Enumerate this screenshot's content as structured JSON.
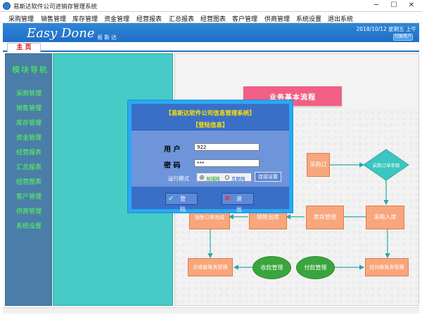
{
  "window": {
    "title": "易斯达软件公司进销存管理系统",
    "controls": [
      "─",
      "☐",
      "✕"
    ]
  },
  "menubar": [
    "采购管理",
    "销售管理",
    "库存管理",
    "资金管理",
    "经营报表",
    "汇总报表",
    "经营图表",
    "客户管理",
    "供商管理",
    "系统设置",
    "退出系统"
  ],
  "banner": {
    "brand": "Easy Done",
    "brand_cn": "易斯达",
    "datetime": "2018/10/12  星期五  上午",
    "switch_label": "切换用户"
  },
  "tab": {
    "label": "主 页"
  },
  "nav": {
    "title": "模块导航",
    "items": [
      "采购管理",
      "销售管理",
      "库存管理",
      "资金管理",
      "经营报表",
      "汇总报表",
      "经营图表",
      "客户管理",
      "供商管理",
      "系统设置"
    ]
  },
  "flow": {
    "title": "业务基本流程",
    "purchase_order": "采购订单",
    "po_approval": "采购订单审核",
    "purchase_in": "采购入库",
    "inventory": "库存管理",
    "sales_out": "销售出库",
    "sales_done": "销售订单完成",
    "receivable": "应收款账务管理",
    "collection": "收款管理",
    "payment": "付款管理",
    "payable": "应付款账务管理"
  },
  "login": {
    "title": "【易斯达软件公司信息管理系统】",
    "subtitle": "【登陆信息】",
    "user_label": "用  户",
    "user_value": "922",
    "pass_label": "密  码",
    "pass_value": "***",
    "mode_label": "运行模式",
    "mode_options": [
      "局域网",
      "互联网"
    ],
    "mode_selected": "局域网",
    "connect_button": "连接设置",
    "login_button": "登 陆",
    "exit_button": "退 出"
  },
  "colors": {
    "banner_blue": "#1f6ec3",
    "nav_text_green": "#58ff58",
    "teal_panel": "#46cbc7",
    "flow_box": "#f8a67c",
    "flow_oval": "#3aa53c",
    "ribbon": "#f25f85",
    "dialog_title_yellow": "#ffe100"
  }
}
